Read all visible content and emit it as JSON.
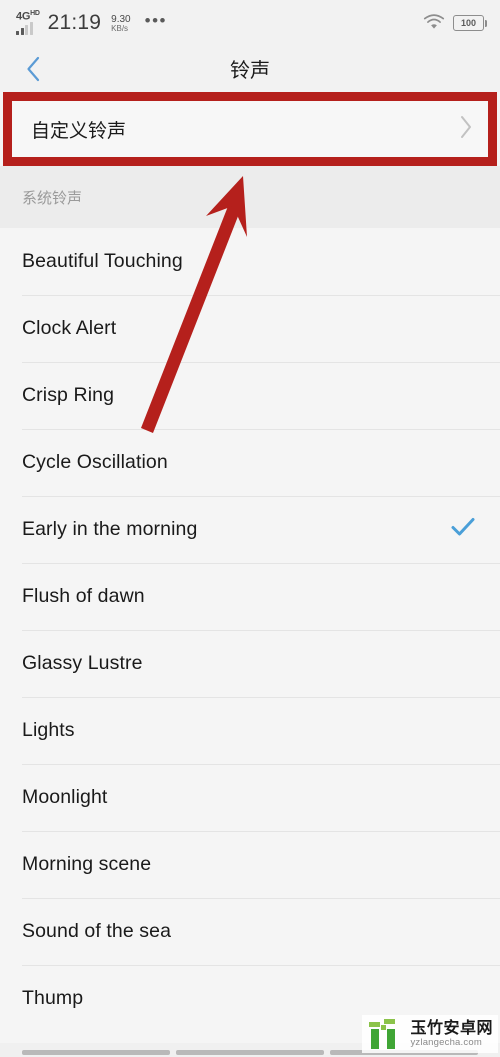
{
  "status_bar": {
    "network_type": "4G",
    "network_type_sup": "HD",
    "time": "21:19",
    "speed_value": "9.30",
    "speed_unit": "KB/s",
    "overflow_dots": "•••",
    "wifi_icon": "wifi-icon",
    "battery_level": "100"
  },
  "title_bar": {
    "back_icon": "back-chevron-icon",
    "title": "铃声"
  },
  "highlight": {
    "border_color": "#b5201c",
    "row_label": "自定义铃声",
    "chevron_icon": "chevron-right-icon"
  },
  "section": {
    "header": "系统铃声"
  },
  "ringtones": [
    {
      "name": "Beautiful Touching",
      "selected": false
    },
    {
      "name": "Clock Alert",
      "selected": false
    },
    {
      "name": "Crisp Ring",
      "selected": false
    },
    {
      "name": "Cycle Oscillation",
      "selected": false
    },
    {
      "name": "Early in the morning",
      "selected": true
    },
    {
      "name": "Flush of dawn",
      "selected": false
    },
    {
      "name": "Glassy Lustre",
      "selected": false
    },
    {
      "name": "Lights",
      "selected": false
    },
    {
      "name": "Moonlight",
      "selected": false
    },
    {
      "name": "Morning scene",
      "selected": false
    },
    {
      "name": "Sound of the sea",
      "selected": false
    },
    {
      "name": "Thump",
      "selected": false
    }
  ],
  "annotation": {
    "arrow_color": "#b5201c",
    "arrow_name": "red-pointer-arrow"
  },
  "watermark": {
    "cn_text": "玉竹安卓网",
    "en_text": "yzlangecha.com",
    "logo_color": "#3fa535"
  },
  "colors": {
    "accent_blue": "#5b9bd5",
    "check_blue": "#4a9fd8",
    "annotation_red": "#b5201c",
    "list_bg": "#f5f5f5",
    "section_bg": "#ececec"
  },
  "nav_bar": {
    "segments": [
      "recent-apps",
      "home",
      "back"
    ]
  }
}
